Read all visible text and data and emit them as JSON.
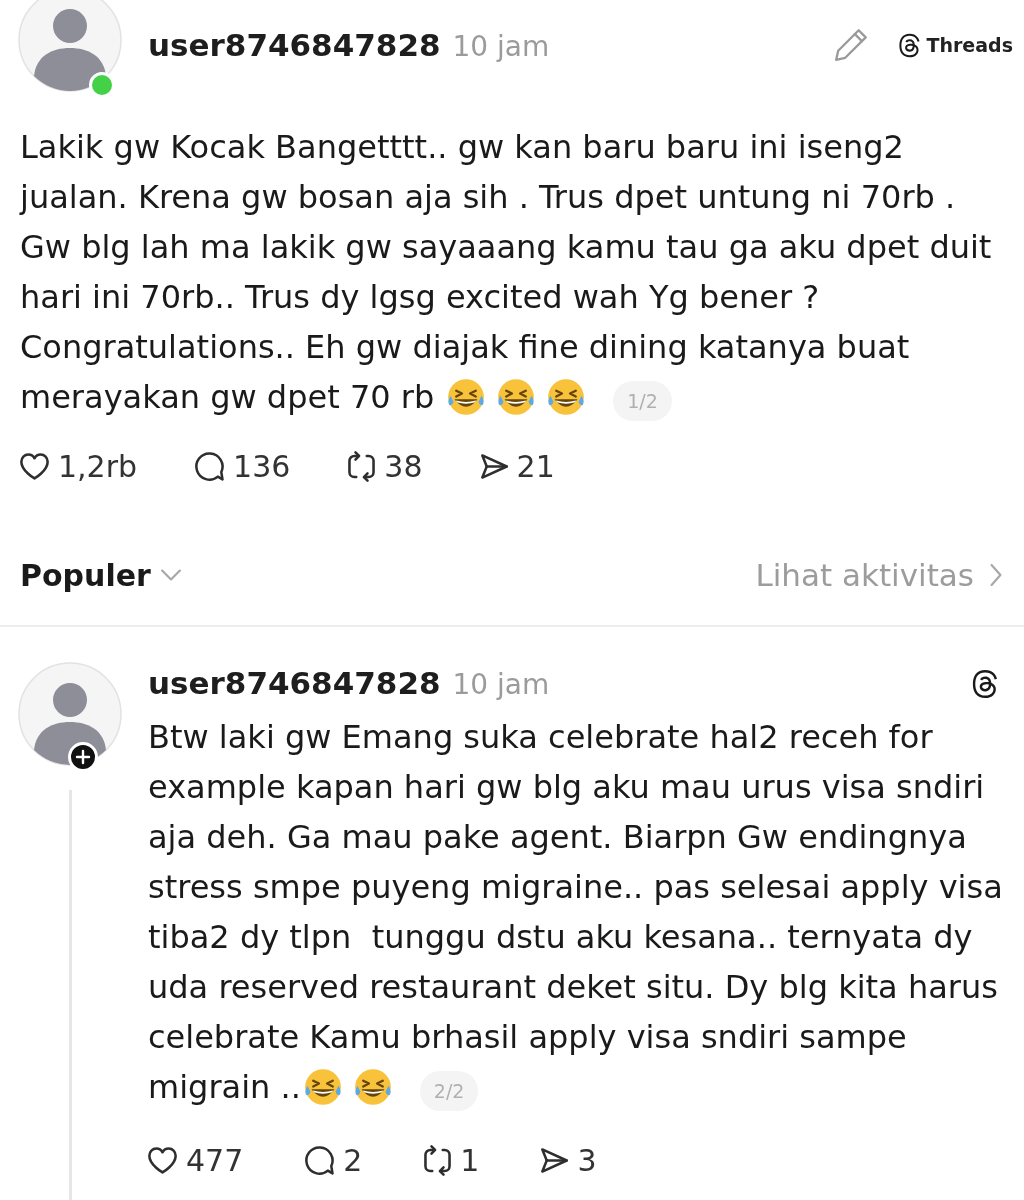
{
  "post": {
    "author": "user8746847828",
    "time": "10 jam",
    "online": true,
    "tools": [
      {
        "kind": "edit"
      },
      {
        "kind": "logo",
        "label": "Threads"
      }
    ],
    "text": "Lakik gw Kocak Bangetttt.. gw kan baru baru ini iseng2\njualan. Krena gw bosan aja sih . Trus dpet untung ni 70rb .\nGw blg lah ma lakik gw sayaaang kamu tau ga aku dpet duit\nhari ini 70rb.. Trus dy lgsg excited wah Yg bener ?\nCongratulations.. Eh gw diajak fine dining katanya buat",
    "text_end": "merayakan gw dpet 70 rb",
    "emojis": [
      {
        "kind": "laughing"
      },
      {
        "kind": "laughing"
      },
      {
        "kind": "laughing"
      }
    ],
    "page": "1/2",
    "stats": [
      {
        "kind": "like",
        "count": "1,2rb"
      },
      {
        "kind": "reply",
        "count": "136"
      },
      {
        "kind": "repost",
        "count": "38"
      },
      {
        "kind": "share",
        "count": "21"
      }
    ]
  },
  "replies_bar": {
    "sort": "Populer",
    "link": "Lihat aktivitas"
  },
  "thread_reply": {
    "author": "user8746847828",
    "time": "10 jam",
    "follow_badge": true,
    "tools": [
      {
        "kind": "logo"
      }
    ],
    "text": "Btw laki gw Emang suka celebrate hal2 receh for\nexample kapan hari gw blg aku mau urus visa sndiri\naja deh. Ga mau pake agent. Biarpn Gw endingnya\nstress smpe puyeng migraine.. pas selesai apply visa\ntiba2 dy tlpn  tunggu dstu aku kesana.. ternyata dy\nuda reserved restaurant deket situ. Dy blg kita harus\ncelebrate Kamu brhasil apply visa sndiri sampe",
    "text_end": "migrain ..",
    "emojis": [
      {
        "kind": "laughing"
      },
      {
        "kind": "laughing"
      }
    ],
    "page": "2/2",
    "stats": [
      {
        "kind": "like",
        "count": "477"
      },
      {
        "kind": "reply",
        "count": "2"
      },
      {
        "kind": "repost",
        "count": "1"
      },
      {
        "kind": "share",
        "count": "3"
      }
    ]
  }
}
